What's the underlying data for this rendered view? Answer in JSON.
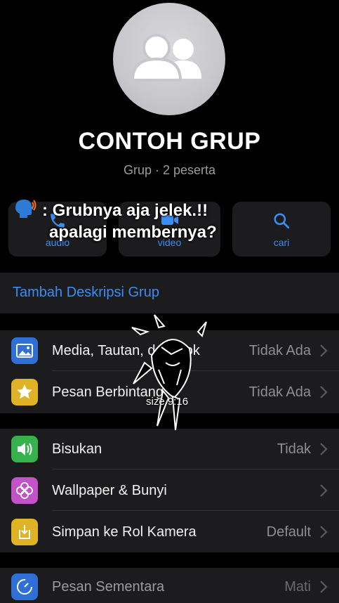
{
  "group": {
    "name": "CONTOH GRUP",
    "subtitle": "Grup · 2 peserta"
  },
  "actions": [
    {
      "label": "audio",
      "icon": "phone-icon"
    },
    {
      "label": "video",
      "icon": "video-icon"
    },
    {
      "label": "cari",
      "icon": "search-icon"
    }
  ],
  "overlay": {
    "line1": ": Grubnya aja jelek.!!",
    "line2": "apalagi membernya?"
  },
  "description_link": "Tambah Deskripsi Grup",
  "section1": [
    {
      "label": "Media, Tautan, dan Dok",
      "value": "Tidak Ada",
      "icon": "photo-icon",
      "color": "#2f6fd6"
    },
    {
      "label": "Pesan Berbintang",
      "value": "Tidak Ada",
      "icon": "star-icon",
      "color": "#e0b326"
    }
  ],
  "section2": [
    {
      "label": "Bisukan",
      "value": "Tidak",
      "icon": "speaker-icon",
      "color": "#35b24b"
    },
    {
      "label": "Wallpaper & Bunyi",
      "value": "",
      "icon": "flower-icon",
      "color": "#c252c7"
    },
    {
      "label": "Simpan ke Rol Kamera",
      "value": "Default",
      "icon": "download-icon",
      "color": "#e0b326"
    }
  ],
  "section3": [
    {
      "label": "Pesan Sementara",
      "value": "Mati",
      "icon": "timer-icon",
      "color": "#2f6fd6"
    }
  ],
  "watermark": {
    "caption": "size 9:16"
  },
  "colors": {
    "accent": "#3a8ef2",
    "background": "#000000",
    "cell": "#1c1c1e"
  }
}
